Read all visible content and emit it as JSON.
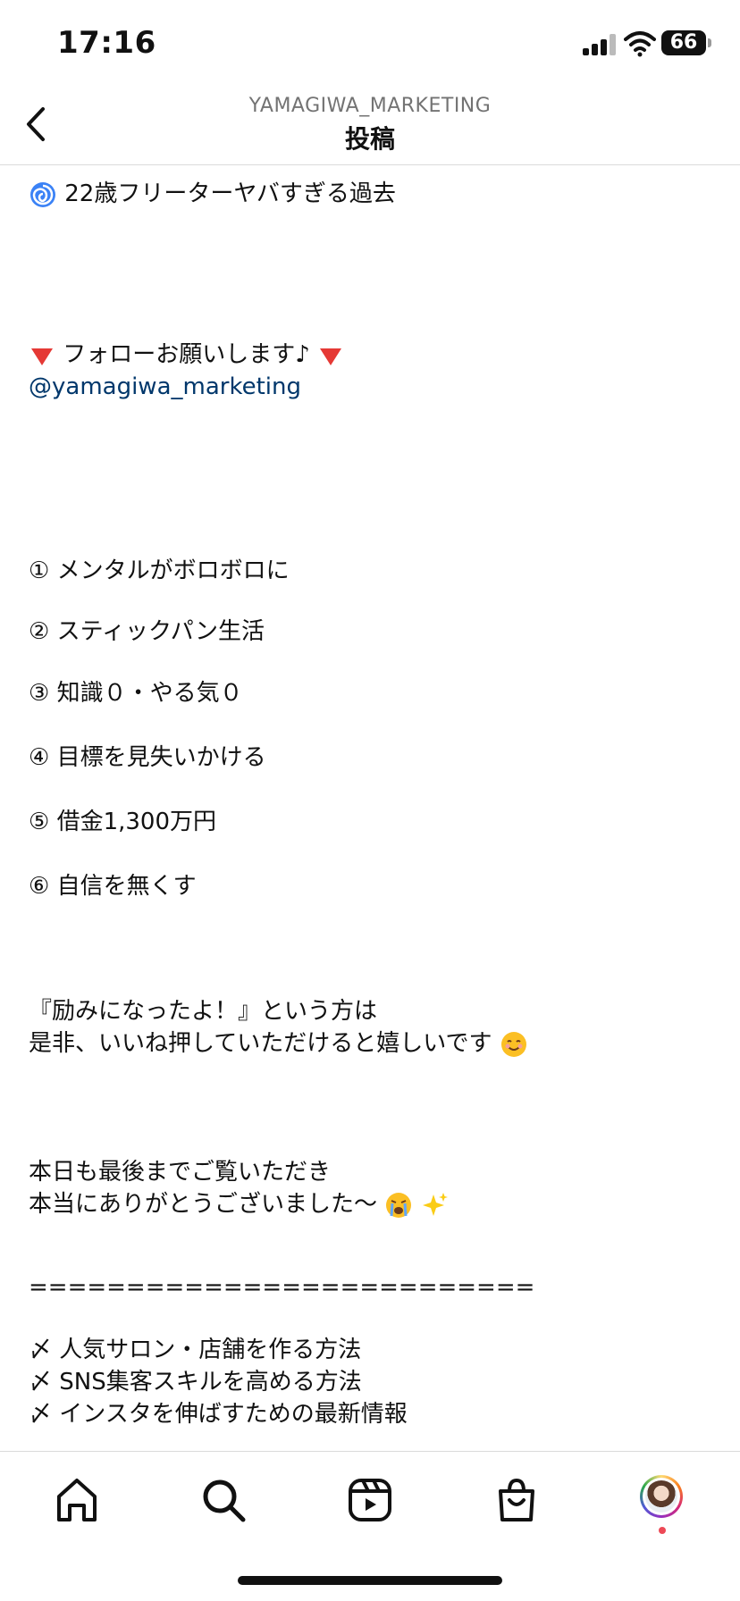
{
  "status_bar": {
    "time": "17:16",
    "battery": "66"
  },
  "header": {
    "username": "YAMAGIWA_MARKETING",
    "title": "投稿"
  },
  "caption": {
    "line_title": "22歳フリーターヤバすぎる過去",
    "follow_text": "フォローお願いします♪",
    "mention": "@yamagiwa_marketing",
    "items": [
      "① メンタルがボロボロに",
      "② スティックパン生活",
      "③ 知識０・やる気０",
      "④ 目標を見失いかける",
      "⑤ 借金1,300万円",
      "⑥ 自信を無くす"
    ],
    "encourage_1": "『励みになったよ！』という方は",
    "encourage_2": "是非、いいね押していただけると嬉しいです",
    "thanks_1": "本日も最後までご覧いただき",
    "thanks_2": "本当にありがとうございました〜",
    "divider": "==========================",
    "bullets": [
      "〆 人気サロン・店舗を作る方法",
      "〆 SNS集客スキルを高める方法",
      "〆 インスタを伸ばすための最新情報"
    ]
  },
  "icons": {
    "back": "chevron-left-icon",
    "tabs": [
      "home-icon",
      "search-icon",
      "reels-icon",
      "shop-icon",
      "profile-avatar"
    ]
  },
  "colors": {
    "mention": "#00376b",
    "badge": "#ed4956",
    "divider": "#dbdbdb"
  }
}
